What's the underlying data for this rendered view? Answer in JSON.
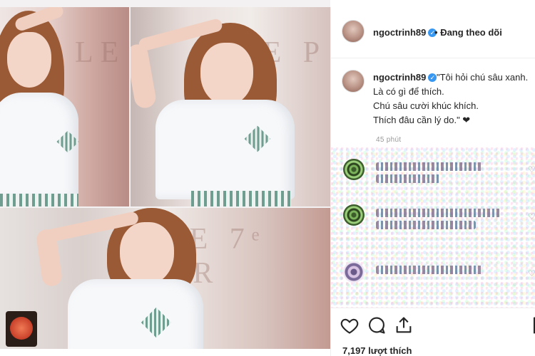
{
  "post": {
    "header": {
      "username": "ngoctrinh89",
      "separator": "•",
      "follow_status": "Đang theo dõi",
      "more": "⋮"
    },
    "caption": {
      "username": "ngoctrinh89",
      "lines": [
        "\"Tôi hỏi chú sâu xanh.",
        "Là có gì để thích.",
        "Chú sâu cười khúc khích.",
        "Thích đâu cần lý do.\" ❤"
      ],
      "time": "45 phút"
    },
    "likes": "7,197 lượt thích",
    "icons": [
      "heart-icon",
      "comment-icon",
      "share-icon",
      "bookmark-icon"
    ]
  },
  "collage": {
    "signs": [
      "LE",
      "LE P",
      "LE 7ᵉ AR"
    ]
  }
}
